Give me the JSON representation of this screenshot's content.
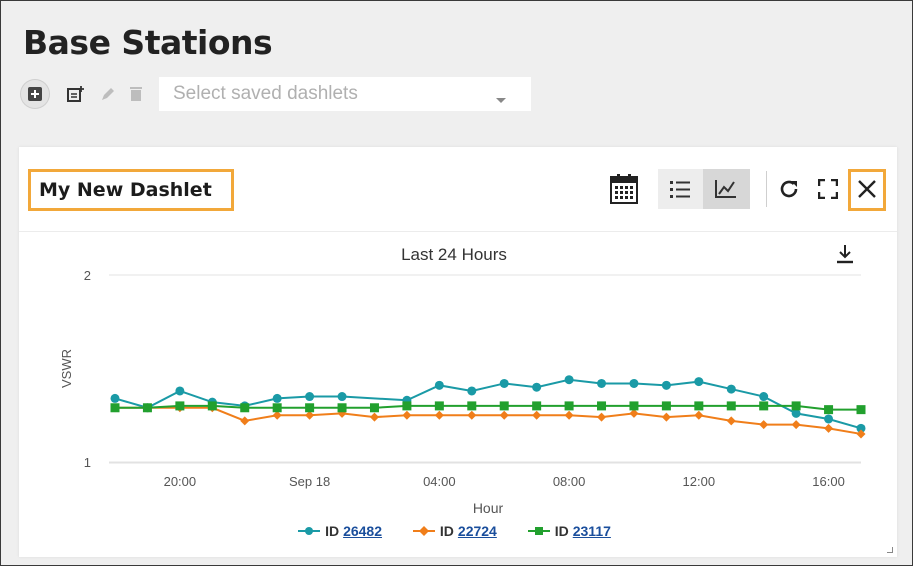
{
  "page": {
    "title": "Base Stations"
  },
  "toolbar": {
    "add_icon": "add-dashlet-icon",
    "new_icon": "new-note-icon",
    "edit_icon": "pencil-icon",
    "delete_icon": "trash-icon",
    "select_placeholder": "Select saved dashlets"
  },
  "dashlet": {
    "title": "My New Dashlet",
    "icons": [
      "calendar-icon",
      "list-icon",
      "chart-icon",
      "refresh-icon",
      "fullscreen-icon",
      "close-icon"
    ],
    "highlight_color": "#f2a83a"
  },
  "chart_data": {
    "type": "line",
    "title": "Last 24 Hours",
    "xlabel": "Hour",
    "ylabel": "VSWR",
    "ylim": [
      1,
      2
    ],
    "yticks": [
      "1",
      "2"
    ],
    "xticks": [
      "20:00",
      "Sep 18",
      "04:00",
      "08:00",
      "12:00",
      "16:00"
    ],
    "x": [
      "18:00",
      "19:00",
      "20:00",
      "21:00",
      "22:00",
      "23:00",
      "00:00",
      "01:00",
      "02:00",
      "03:00",
      "04:00",
      "05:00",
      "06:00",
      "07:00",
      "08:00",
      "09:00",
      "10:00",
      "11:00",
      "12:00",
      "13:00",
      "14:00",
      "15:00",
      "16:00",
      "17:00"
    ],
    "grid": true,
    "legend_position": "bottom",
    "series": [
      {
        "name": "ID",
        "id": "26482",
        "color": "#1a9aa6",
        "marker": "circle",
        "values": [
          1.34,
          1.29,
          1.38,
          1.32,
          1.3,
          1.34,
          1.35,
          1.35,
          null,
          1.33,
          1.41,
          1.38,
          1.42,
          1.4,
          1.44,
          1.42,
          1.42,
          1.41,
          1.43,
          1.39,
          1.35,
          1.26,
          1.23,
          1.18
        ]
      },
      {
        "name": "ID",
        "id": "22724",
        "color": "#f07e1a",
        "marker": "diamond",
        "values": [
          1.29,
          1.29,
          1.29,
          1.29,
          1.22,
          1.25,
          1.25,
          1.26,
          1.24,
          1.25,
          1.25,
          1.25,
          1.25,
          1.25,
          1.25,
          1.24,
          1.26,
          1.24,
          1.25,
          1.22,
          1.2,
          1.2,
          1.18,
          1.15
        ]
      },
      {
        "name": "ID",
        "id": "23117",
        "color": "#22a02e",
        "marker": "square",
        "values": [
          1.29,
          1.29,
          1.3,
          1.3,
          1.29,
          1.29,
          1.29,
          1.29,
          1.29,
          1.3,
          1.3,
          1.3,
          1.3,
          1.3,
          1.3,
          1.3,
          1.3,
          1.3,
          1.3,
          1.3,
          1.3,
          1.3,
          1.28,
          1.28
        ]
      }
    ]
  }
}
